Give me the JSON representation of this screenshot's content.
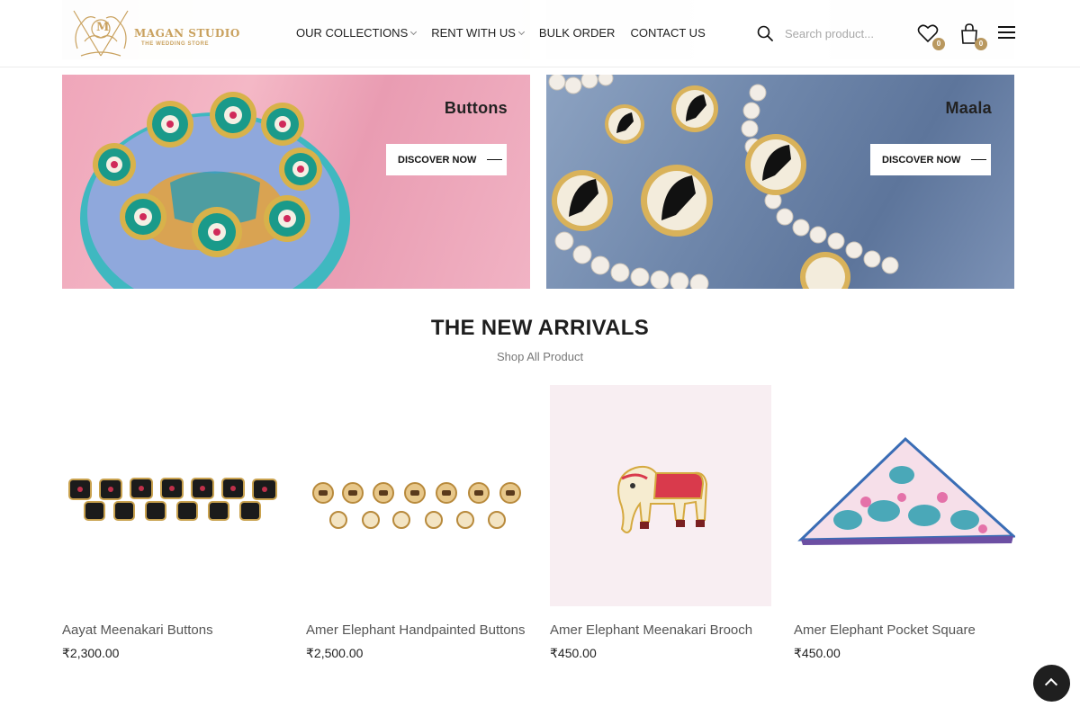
{
  "header": {
    "brand": "MAGAN STUDIO",
    "tagline": "THE WEDDING STORE",
    "logo_monogram": "M",
    "nav": [
      {
        "label": "OUR COLLECTIONS",
        "has_dropdown": true
      },
      {
        "label": "RENT WITH US",
        "has_dropdown": true
      },
      {
        "label": "BULK ORDER",
        "has_dropdown": false
      },
      {
        "label": "CONTACT US",
        "has_dropdown": false
      }
    ],
    "search": {
      "placeholder": "Search product..."
    },
    "wishlist_count": "0",
    "cart_count": "0",
    "accent_color": "#b9985f"
  },
  "banners": [
    {
      "title": "Buttons",
      "cta": "DISCOVER NOW"
    },
    {
      "title": "Maala",
      "cta": "DISCOVER NOW"
    }
  ],
  "arrivals": {
    "title": "THE NEW ARRIVALS",
    "subtitle": "Shop All Product",
    "products": [
      {
        "name": "Aayat Meenakari Buttons",
        "price": "₹2,300.00"
      },
      {
        "name": "Amer Elephant Handpainted Buttons",
        "price": "₹2,500.00"
      },
      {
        "name": "Amer Elephant Meenakari Brooch",
        "price": "₹450.00"
      },
      {
        "name": "Amer Elephant Pocket Square",
        "price": "₹450.00"
      }
    ]
  },
  "icons": {
    "search": "search-icon",
    "wishlist": "heart-icon",
    "cart": "shopping-bag-icon",
    "menu": "hamburger-icon",
    "scroll_top": "chevron-up-icon"
  }
}
